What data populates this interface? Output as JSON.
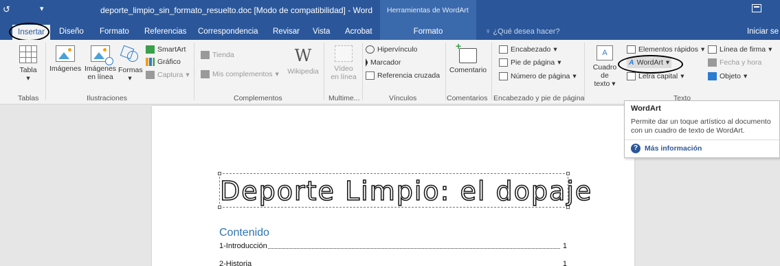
{
  "titlebar": {
    "undo_icon": "undo-icon",
    "customize_icon": "qa-customize-icon",
    "title": "deporte_limpio_sin_formato_resuelto.doc [Modo de compatibilidad] - Word",
    "tools_label": "Herramientas de WordArt"
  },
  "tabs": {
    "insertar": "Insertar",
    "diseno": "Diseño",
    "formato": "Formato",
    "referencias": "Referencias",
    "correspondencia": "Correspondencia",
    "revisar": "Revisar",
    "vista": "Vista",
    "acrobat": "Acrobat",
    "formato_tools": "Formato",
    "tell_me": "¿Qué desea hacer?",
    "signin": "Iniciar se"
  },
  "ribbon": {
    "tablas": {
      "tabla": "Tabla",
      "group": "Tablas"
    },
    "ilustraciones": {
      "imagenes": "Imágenes",
      "imagenes_linea_1": "Imágenes",
      "imagenes_linea_2": "en línea",
      "formas": "Formas",
      "smartart": "SmartArt",
      "grafico": "Gráfico",
      "captura": "Captura",
      "group": "Ilustraciones"
    },
    "complementos": {
      "tienda": "Tienda",
      "mis_complementos": "Mis complementos",
      "wikipedia": "Wikipedia",
      "group": "Complementos"
    },
    "multimedia": {
      "video_1": "Vídeo",
      "video_2": "en línea",
      "group": "Multime..."
    },
    "vinculos": {
      "hipervinculo": "Hipervínculo",
      "marcador": "Marcador",
      "referencia_cruzada": "Referencia cruzada",
      "group": "Vínculos"
    },
    "comentarios": {
      "comentario": "Comentario",
      "group": "Comentarios"
    },
    "encabezado": {
      "encabezado": "Encabezado",
      "pie": "Pie de página",
      "numero": "Número de página",
      "group": "Encabezado y pie de página"
    },
    "texto": {
      "cuadro_1": "Cuadro de",
      "cuadro_2": "texto",
      "elementos_rapidos": "Elementos rápidos",
      "wordart": "WordArt",
      "letra_capital": "Letra capital",
      "linea_firma": "Línea de firma",
      "fecha_hora": "Fecha y hora",
      "objeto": "Objeto",
      "group": "Texto"
    }
  },
  "tooltip": {
    "title": "WordArt",
    "description": "Permite dar un toque artístico al documento con un cuadro de texto de WordArt.",
    "help_link": "Más información"
  },
  "document": {
    "wordart_title": "Deporte Limpio: el dopaje",
    "toc_heading": "Contenido",
    "toc": [
      {
        "label": "1-Introducción",
        "page": "1"
      },
      {
        "label": "2-Historia",
        "page": "1"
      }
    ]
  },
  "colors": {
    "accent": "#2b579a",
    "tools_band": "#3b6aac",
    "ribbon_bg": "#f3f3f3",
    "heading_blue": "#2e74b5"
  }
}
